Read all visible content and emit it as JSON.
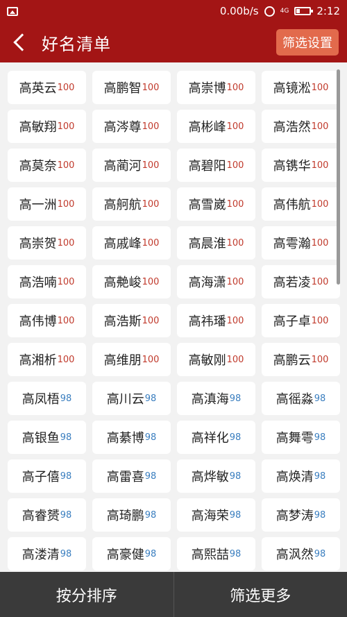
{
  "status_bar": {
    "net_speed": "0.00b/s",
    "network": "4G",
    "time": "2:12"
  },
  "header": {
    "title": "好名清单",
    "filter_settings_label": "筛选设置"
  },
  "names": [
    {
      "name": "高英云",
      "score": "100"
    },
    {
      "name": "高鹏智",
      "score": "100"
    },
    {
      "name": "高崇博",
      "score": "100"
    },
    {
      "name": "高镜淞",
      "score": "100"
    },
    {
      "name": "高敏翔",
      "score": "100"
    },
    {
      "name": "高涔尊",
      "score": "100"
    },
    {
      "name": "高彬峰",
      "score": "100"
    },
    {
      "name": "高浩然",
      "score": "100"
    },
    {
      "name": "高莫奈",
      "score": "100"
    },
    {
      "name": "高蔺河",
      "score": "100"
    },
    {
      "name": "高碧阳",
      "score": "100"
    },
    {
      "name": "高镌华",
      "score": "100"
    },
    {
      "name": "高一洲",
      "score": "100"
    },
    {
      "name": "高舸航",
      "score": "100"
    },
    {
      "name": "高雪崴",
      "score": "100"
    },
    {
      "name": "高伟航",
      "score": "100"
    },
    {
      "name": "高崇贺",
      "score": "100"
    },
    {
      "name": "高戚峰",
      "score": "100"
    },
    {
      "name": "高晨淮",
      "score": "100"
    },
    {
      "name": "高雩瀚",
      "score": "100"
    },
    {
      "name": "高浩喃",
      "score": "100"
    },
    {
      "name": "高艴峻",
      "score": "100"
    },
    {
      "name": "高海潇",
      "score": "100"
    },
    {
      "name": "高若凌",
      "score": "100"
    },
    {
      "name": "高伟博",
      "score": "100"
    },
    {
      "name": "高浩斯",
      "score": "100"
    },
    {
      "name": "高祎璠",
      "score": "100"
    },
    {
      "name": "高子卓",
      "score": "100"
    },
    {
      "name": "高湘析",
      "score": "100"
    },
    {
      "name": "高维朋",
      "score": "100"
    },
    {
      "name": "高敏刚",
      "score": "100"
    },
    {
      "name": "高鹏云",
      "score": "100"
    },
    {
      "name": "高凤梧",
      "score": "98"
    },
    {
      "name": "高川云",
      "score": "98"
    },
    {
      "name": "高滇海",
      "score": "98"
    },
    {
      "name": "高徭淼",
      "score": "98"
    },
    {
      "name": "高银鱼",
      "score": "98"
    },
    {
      "name": "高綦博",
      "score": "98"
    },
    {
      "name": "高祥化",
      "score": "98"
    },
    {
      "name": "高舞雩",
      "score": "98"
    },
    {
      "name": "高子僖",
      "score": "98"
    },
    {
      "name": "高雷喜",
      "score": "98"
    },
    {
      "name": "高烨敏",
      "score": "98"
    },
    {
      "name": "高焕清",
      "score": "98"
    },
    {
      "name": "高睿赟",
      "score": "98"
    },
    {
      "name": "高琦鹏",
      "score": "98"
    },
    {
      "name": "高海荣",
      "score": "98"
    },
    {
      "name": "高梦涛",
      "score": "98"
    },
    {
      "name": "高溇清",
      "score": "98"
    },
    {
      "name": "高豪健",
      "score": "98"
    },
    {
      "name": "高熙喆",
      "score": "98"
    },
    {
      "name": "高沨然",
      "score": "98"
    }
  ],
  "bottom_bar": {
    "sort_by_score_label": "按分排序",
    "filter_more_label": "筛选更多"
  },
  "colors": {
    "brand_red": "#a31515",
    "score_high": "#c0392b",
    "score_mid": "#3a7ebf"
  }
}
